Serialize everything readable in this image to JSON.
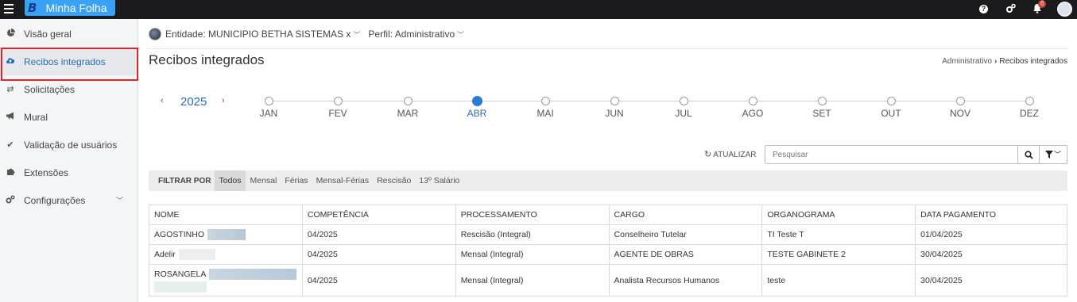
{
  "topbar": {
    "brand_letter": "B",
    "app_name": "Minha Folha",
    "notification_count": "6",
    "icons": [
      "menu-icon",
      "help-icon",
      "settings-icon",
      "bell-icon",
      "avatar"
    ]
  },
  "sidebar": {
    "items": [
      {
        "label": "Visão geral",
        "icon": "pie-chart-icon"
      },
      {
        "label": "Recibos integrados",
        "icon": "cloud-upload-icon",
        "active": true
      },
      {
        "label": "Solicitações",
        "icon": "exchange-icon"
      },
      {
        "label": "Mural",
        "icon": "megaphone-icon"
      },
      {
        "label": "Validação de usuários",
        "icon": "check-icon"
      },
      {
        "label": "Extensões",
        "icon": "puzzle-icon"
      },
      {
        "label": "Configurações",
        "icon": "cogs-icon"
      }
    ]
  },
  "context": {
    "entity": "Entidade: MUNICIPIO BETHA SISTEMAS x",
    "profile": "Perfil: Administrativo"
  },
  "page": {
    "title": "Recibos integrados",
    "breadcrumb_parent": "Administrativo",
    "breadcrumb_current": "Recibos integrados"
  },
  "timeline": {
    "year": "2025",
    "months": [
      "JAN",
      "FEV",
      "MAR",
      "ABR",
      "MAI",
      "JUN",
      "JUL",
      "AGO",
      "SET",
      "OUT",
      "NOV",
      "DEZ"
    ],
    "selected_month": "ABR"
  },
  "toolbar": {
    "refresh_label": "ATUALIZAR",
    "search_placeholder": "Pesquisar"
  },
  "filter": {
    "label": "FILTRAR POR",
    "options": [
      "Todos",
      "Mensal",
      "Férias",
      "Mensal-Férias",
      "Rescisão",
      "13º Salário"
    ],
    "selected": "Todos"
  },
  "table": {
    "columns": [
      "NOME",
      "COMPETÊNCIA",
      "PROCESSAMENTO",
      "CARGO",
      "ORGANOGRAMA",
      "DATA PAGAMENTO"
    ],
    "rows": [
      {
        "nome": "AGOSTINHO",
        "competencia": "04/2025",
        "processamento": "Rescisão (Integral)",
        "cargo": "Conselheiro Tutelar",
        "organograma": "TI Teste T",
        "data_pagamento": "01/04/2025"
      },
      {
        "nome": "Adelir",
        "competencia": "04/2025",
        "processamento": "Mensal (Integral)",
        "cargo": "AGENTE DE OBRAS",
        "organograma": "TESTE GABINETE 2",
        "data_pagamento": "30/04/2025"
      },
      {
        "nome": "ROSANGELA",
        "competencia": "04/2025",
        "processamento": "Mensal (Integral)",
        "cargo": "Analista Recursos Humanos",
        "organograma": "teste",
        "data_pagamento": "30/04/2025"
      }
    ]
  }
}
